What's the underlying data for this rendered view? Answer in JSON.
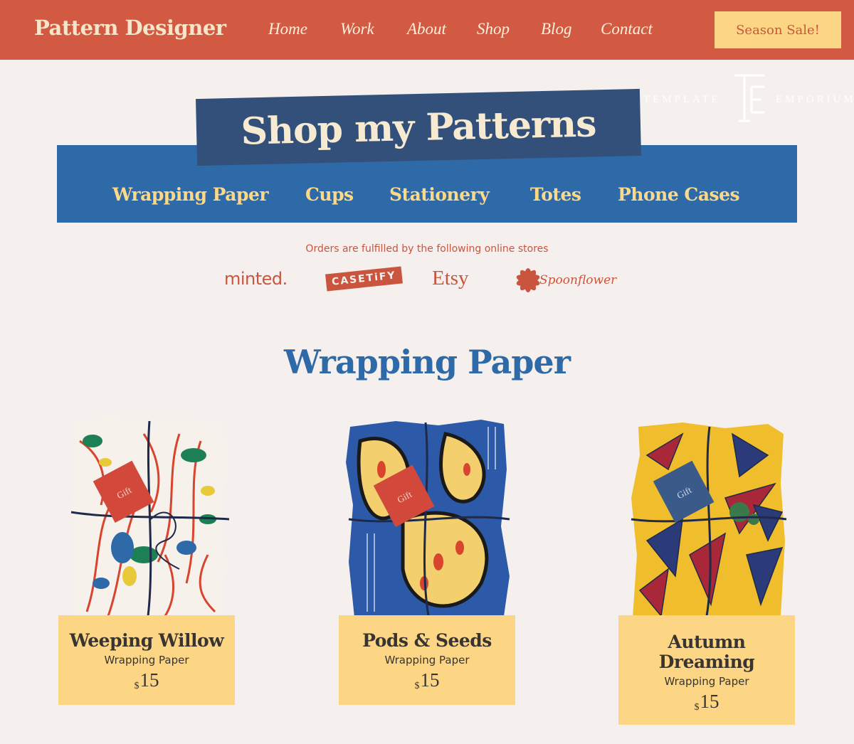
{
  "header": {
    "brand": "Pattern Designer",
    "nav": [
      "Home",
      "Work",
      "About",
      "Shop",
      "Blog",
      "Contact"
    ],
    "sale_button": "Season Sale!"
  },
  "watermark": {
    "left": "TEMPLATE",
    "right": "EMPORIUM",
    "monogram": "TE"
  },
  "hero": {
    "title": "Shop my Patterns",
    "categories": [
      "Wrapping Paper",
      "Cups",
      "Stationery",
      "Totes",
      "Phone Cases"
    ]
  },
  "stores": {
    "caption": "Orders are fulfilled by the following online stores",
    "items": [
      "minted.",
      "CASETiFY",
      "Etsy",
      "Spoonflower"
    ]
  },
  "section": {
    "title": "Wrapping Paper"
  },
  "products": [
    {
      "name": "Weeping Willow",
      "type": "Wrapping Paper",
      "currency": "$",
      "price": "15",
      "tag": "Gift"
    },
    {
      "name": "Pods & Seeds",
      "type": "Wrapping Paper",
      "currency": "$",
      "price": "15",
      "tag": "Gift"
    },
    {
      "name": "Autumn Dreaming",
      "type": "Wrapping Paper",
      "currency": "$",
      "price": "15",
      "tag": "Gift"
    }
  ],
  "colors": {
    "header_bg": "#d25a43",
    "band_bg": "#2e6aa8",
    "banner_bg": "#33507a",
    "card_bg": "#fcd684",
    "accent_text": "#c9553f"
  }
}
